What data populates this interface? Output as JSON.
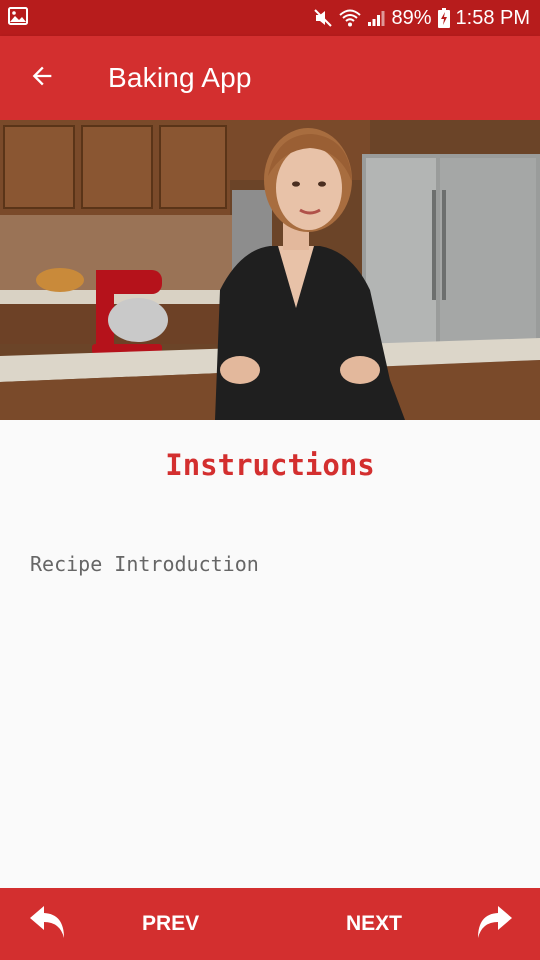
{
  "status_bar": {
    "battery": "89%",
    "time": "1:58 PM",
    "icons": [
      "image-icon",
      "mute-icon",
      "wifi-icon",
      "signal-icon",
      "battery-charging-icon"
    ]
  },
  "app_bar": {
    "title": "Baking App",
    "back_icon": "arrow-back-icon"
  },
  "video": {
    "type": "video-player-still",
    "content": "presenter-in-kitchen"
  },
  "step": {
    "heading": "Instructions",
    "description": "Recipe Introduction"
  },
  "bottom_nav": {
    "prev_label": "PREV",
    "next_label": "NEXT",
    "prev_icon": "undo-arrow-icon",
    "next_icon": "redo-arrow-icon"
  },
  "colors": {
    "status_bar": "#b71c1c",
    "primary": "#d32f2f",
    "background": "#fafafa",
    "description_text": "#666666"
  }
}
